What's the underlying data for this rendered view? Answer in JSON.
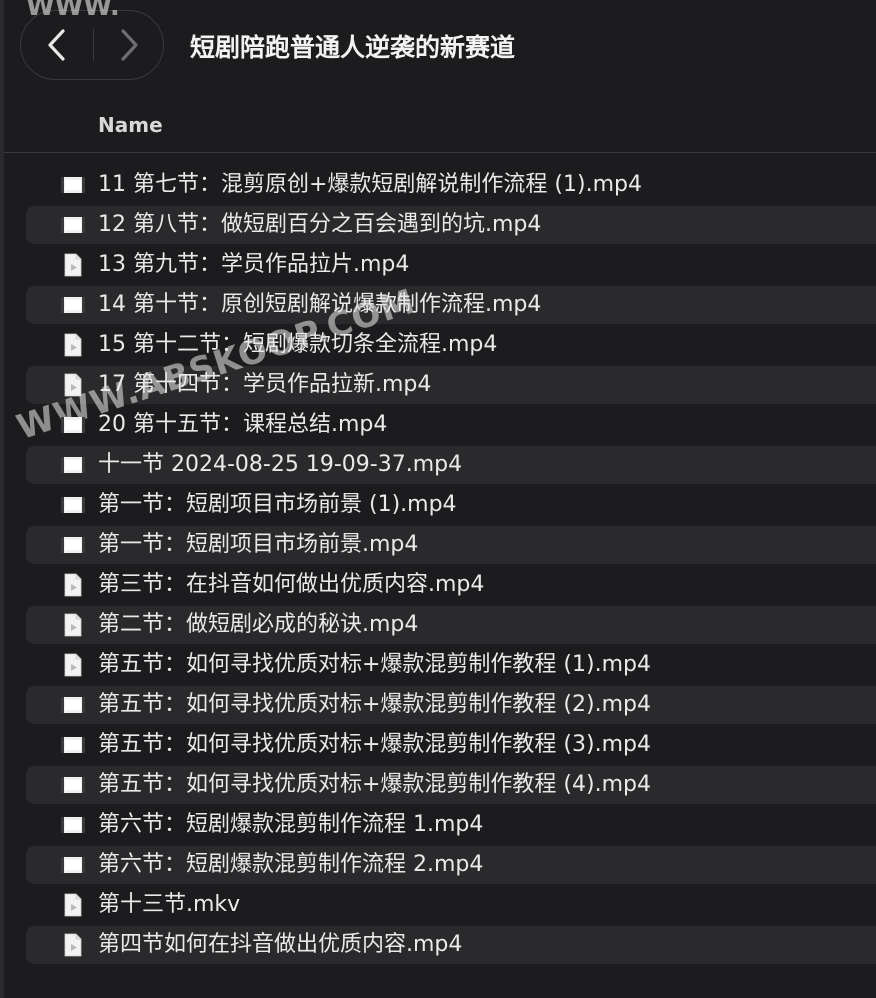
{
  "window": {
    "title": "短剧陪跑普通人逆袭的新赛道"
  },
  "columns": {
    "name": "Name"
  },
  "files": [
    {
      "name": "11 第七节：混剪原创+爆款短剧解说制作流程 (1).mp4",
      "icon": "video-thumbnail-icon"
    },
    {
      "name": "12 第八节：做短剧百分之百会遇到的坑.mp4",
      "icon": "video-thumbnail-icon"
    },
    {
      "name": "13 第九节：学员作品拉片.mp4",
      "icon": "document-icon"
    },
    {
      "name": "14 第十节：原创短剧解说爆款制作流程.mp4",
      "icon": "video-thumbnail-icon"
    },
    {
      "name": "15 第十二节：短剧爆款切条全流程.mp4",
      "icon": "document-icon"
    },
    {
      "name": "17 第十四节：学员作品拉新.mp4",
      "icon": "document-icon"
    },
    {
      "name": "20 第十五节：课程总结.mp4",
      "icon": "video-thumbnail-icon"
    },
    {
      "name": "十一节 2024-08-25 19-09-37.mp4",
      "icon": "video-thumbnail-icon"
    },
    {
      "name": "第一节：短剧项目市场前景 (1).mp4",
      "icon": "video-thumbnail-icon"
    },
    {
      "name": "第一节：短剧项目市场前景.mp4",
      "icon": "video-thumbnail-icon"
    },
    {
      "name": "第三节：在抖音如何做出优质内容.mp4",
      "icon": "document-icon"
    },
    {
      "name": "第二节：做短剧必成的秘诀.mp4",
      "icon": "document-icon"
    },
    {
      "name": "第五节：如何寻找优质对标+爆款混剪制作教程 (1).mp4",
      "icon": "document-icon"
    },
    {
      "name": "第五节：如何寻找优质对标+爆款混剪制作教程 (2).mp4",
      "icon": "video-thumbnail-icon"
    },
    {
      "name": "第五节：如何寻找优质对标+爆款混剪制作教程 (3).mp4",
      "icon": "video-thumbnail-icon"
    },
    {
      "name": "第五节：如何寻找优质对标+爆款混剪制作教程 (4).mp4",
      "icon": "video-thumbnail-icon"
    },
    {
      "name": "第六节：短剧爆款混剪制作流程 1.mp4",
      "icon": "video-thumbnail-icon"
    },
    {
      "name": "第六节：短剧爆款混剪制作流程 2.mp4",
      "icon": "video-thumbnail-icon"
    },
    {
      "name": "第十三节.mkv",
      "icon": "document-icon"
    },
    {
      "name": "第四节如何在抖音做出优质内容.mp4",
      "icon": "document-icon"
    }
  ],
  "watermark": {
    "top": "WWW.",
    "center": "WWW.ABSKOOP.COM"
  },
  "colors": {
    "background": "#1c1c1e",
    "stripe": "#2a2a2c",
    "text": "#e9e9e9"
  }
}
